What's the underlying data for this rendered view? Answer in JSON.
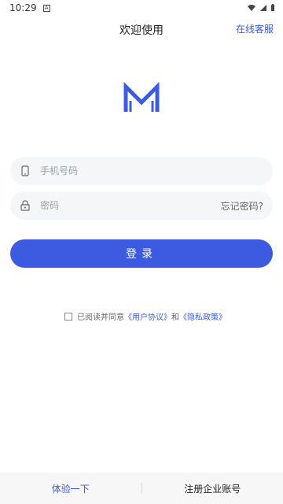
{
  "status_bar": {
    "time": "10:29",
    "notification_glyph": "A"
  },
  "header": {
    "title": "欢迎使用",
    "action": "在线客服"
  },
  "phone_field": {
    "placeholder": "手机号码",
    "icon": "phone-icon"
  },
  "password_field": {
    "placeholder": "密码",
    "icon": "lock-icon",
    "forgot": "忘记密码?"
  },
  "login_button": "登录",
  "agreement": {
    "prefix": "已阅读并同意",
    "user_agreement": "《用户协议》",
    "and": "和",
    "privacy_policy": "《隐私政策》"
  },
  "footer": {
    "left": "体验一下",
    "right": "注册企业账号"
  },
  "colors": {
    "accent": "#3C5BE0",
    "input_bg": "#F5F6F8",
    "footer_bg": "#F7F7F7"
  }
}
